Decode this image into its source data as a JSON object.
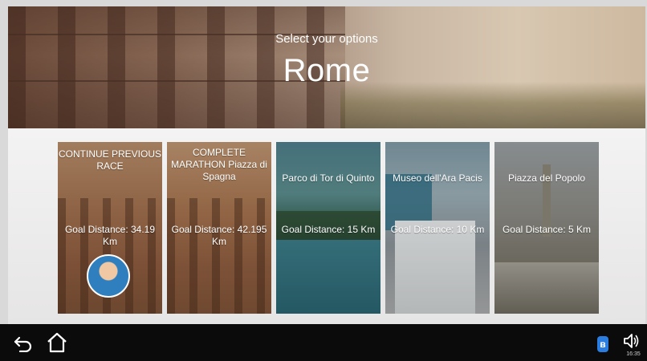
{
  "header": {
    "subtitle": "Select your options",
    "title": "Rome"
  },
  "cards": [
    {
      "title": "CONTINUE PREVIOUS RACE",
      "distance": "Goal Distance: 34.19 Km",
      "has_avatar": true
    },
    {
      "title": "COMPLETE MARATHON Piazza di Spagna",
      "distance": "Goal Distance: 42.195 Km"
    },
    {
      "title": "Parco di Tor di Quinto",
      "distance": "Goal Distance: 15 Km"
    },
    {
      "title": "Museo dell'Ara Pacis",
      "distance": "Goal Distance: 10 Km"
    },
    {
      "title": "Piazza del Popolo",
      "distance": "Goal Distance: 5 Km"
    }
  ],
  "navbar": {
    "back_icon": "back-arrow-icon",
    "home_icon": "home-icon",
    "bluetooth_icon": "bluetooth-icon",
    "bluetooth_glyph": "ʙ",
    "volume_icon": "speaker-icon",
    "time": "16:35"
  },
  "colors": {
    "bluetooth": "#2b7de0",
    "navbar_bg": "#0b0b0b",
    "text": "#ffffff"
  }
}
